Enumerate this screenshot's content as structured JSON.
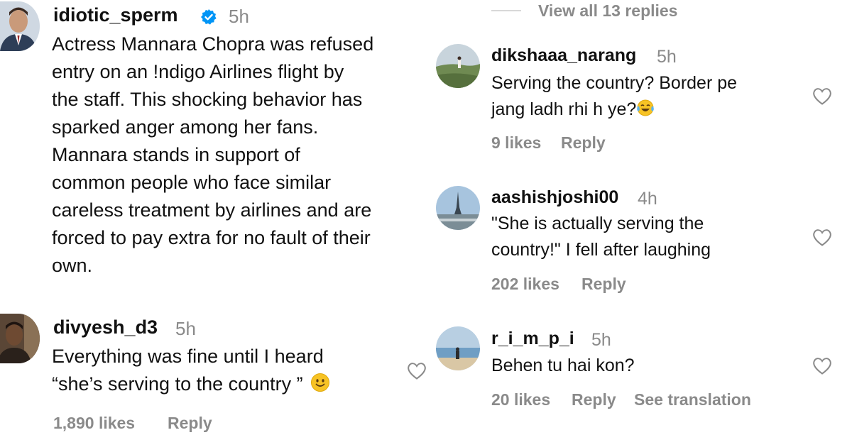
{
  "left": {
    "post": {
      "username": "idiotic_sperm",
      "verified": true,
      "time": "5h",
      "lines": [
        "Actress Mannara Chopra was refused",
        "entry on an !ndigo Airlines flight by",
        "the staff. This shocking behavior has",
        "sparked anger among her fans.",
        "Mannara stands in support of",
        "common people who face similar",
        "careless treatment by airlines and are",
        "forced to pay extra for no fault of their",
        "own."
      ]
    },
    "comment": {
      "username": "divyesh_d3",
      "time": "5h",
      "line1": "Everything was fine until I heard",
      "line2": "“she’s serving to the country ”",
      "likes": "1,890 likes",
      "reply": "Reply"
    }
  },
  "right": {
    "view_replies": "View all 13 replies",
    "replies": [
      {
        "username": "dikshaaa_narang",
        "time": "5h",
        "line1": "Serving the country? Border pe",
        "line2": "jang ladh rhi h ye?",
        "emoji": "laughing-tears",
        "likes": "9 likes",
        "reply": "Reply"
      },
      {
        "username": "aashishjoshi00",
        "time": "4h",
        "line1": "\"She is actually serving the",
        "line2": "country!\" I fell after laughing",
        "likes": "202 likes",
        "reply": "Reply"
      },
      {
        "username": "r_i_m_p_i",
        "time": "5h",
        "line1": "Behen tu hai kon?",
        "likes": "20 likes",
        "reply": "Reply",
        "translate": "See translation"
      }
    ]
  },
  "colors": {
    "text": "#111111",
    "muted": "#8a8a8a",
    "verified": "#0095f6",
    "emoji": "#f7c325"
  },
  "icons": [
    "verified-badge-icon",
    "heart-icon",
    "smile-emoji-icon",
    "laughing-tears-emoji-icon"
  ]
}
